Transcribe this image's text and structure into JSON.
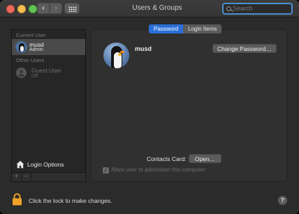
{
  "window": {
    "title": "Users & Groups"
  },
  "toolbar": {
    "back_glyph": "‹",
    "forward_glyph": "›",
    "search_placeholder": "Search"
  },
  "sidebar": {
    "current_user_label": "Current User",
    "current_user": {
      "name": "musd",
      "role": "Admin"
    },
    "other_users_label": "Other Users",
    "guest_user": {
      "name": "Guest User",
      "status": "Off"
    },
    "login_options_label": "Login Options",
    "add_glyph": "+",
    "remove_glyph": "−"
  },
  "tabs": [
    {
      "label": "Password",
      "active": true
    },
    {
      "label": "Login Items",
      "active": false
    }
  ],
  "main": {
    "user_name": "musd",
    "change_password_label": "Change Password…",
    "contacts_card_label": "Contacts Card:",
    "open_label": "Open…",
    "admin_checkbox_label": "Allow user to administer this computer",
    "admin_checked": true,
    "admin_check_glyph": "✓"
  },
  "footer": {
    "lock_text": "Click the lock to make changes.",
    "help_glyph": "?"
  },
  "colors": {
    "accent": "#2a6fd8",
    "lock": "#f0a127",
    "window_bg": "#2b2b2b"
  },
  "icons": [
    "search-icon",
    "grid-icon",
    "home-icon",
    "lock-icon",
    "help-icon",
    "penguin-avatar",
    "guest-user-icon"
  ]
}
